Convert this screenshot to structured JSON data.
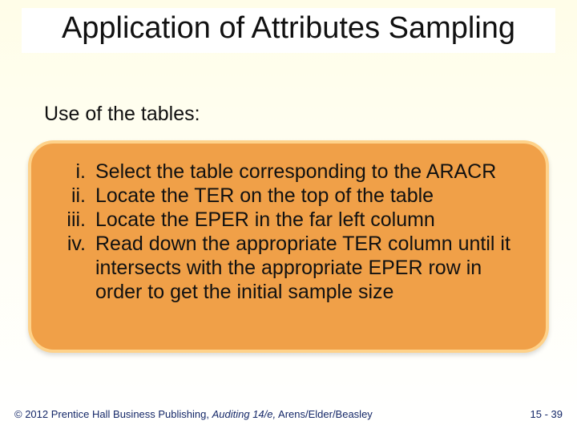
{
  "title": "Application of Attributes Sampling",
  "subtitle": "Use of the tables:",
  "items": [
    {
      "num": "i.",
      "txt": "Select the table corresponding to the ARACR"
    },
    {
      "num": "ii.",
      "txt": "Locate the TER on the top of the table"
    },
    {
      "num": "iii.",
      "txt": "Locate the EPER in the far left column"
    },
    {
      "num": "iv.",
      "txt": "Read down the appropriate TER column until it intersects with the appropriate EPER row in order to get the initial sample size"
    }
  ],
  "footer": {
    "copyright_prefix": "© 2012 Prentice Hall Business Publishing, ",
    "book_title": "Auditing 14/e,",
    "authors": " Arens/Elder/Beasley",
    "page": "15 - 39"
  }
}
